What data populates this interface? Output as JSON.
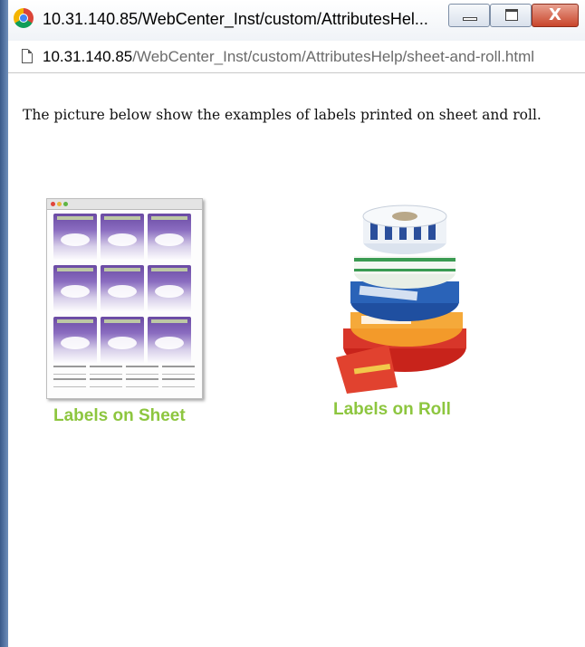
{
  "window": {
    "title": "10.31.140.85/WebCenter_Inst/custom/AttributesHel...",
    "close_glyph": "X"
  },
  "address": {
    "host": "10.31.140.85",
    "path": "/WebCenter_Inst/custom/AttributesHelp/sheet-and-roll.html"
  },
  "content": {
    "intro": "The picture below show the examples of labels printed on sheet and roll.",
    "caption_sheet": "Labels on Sheet",
    "caption_roll": "Labels on Roll",
    "caption_color": "#8dc63f"
  },
  "icons": [
    "chrome-icon",
    "page-icon",
    "minimize-icon",
    "maximize-icon",
    "close-icon"
  ]
}
